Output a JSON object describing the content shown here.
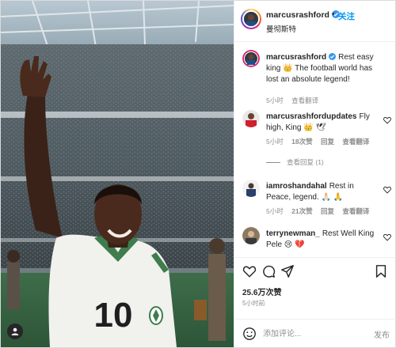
{
  "post": {
    "author": "marcusrashford",
    "follow_label": "关注",
    "dot": "•",
    "location": "曼彻斯特",
    "caption": "Rest easy king 👑 The football world has lost an absolute legend!",
    "caption_time": "5小时",
    "see_translation": "查看翻译",
    "jersey_number": "10"
  },
  "comments": [
    {
      "user": "marcusrashfordupdates",
      "text": "Fly high, King 👑 🕊",
      "time": "5小时",
      "likes": "18次赞",
      "reply": "回复",
      "translate": "查看翻译"
    },
    {
      "view_replies": "查看回复 (1)"
    },
    {
      "user": "iamroshandahal",
      "text": "Rest in Peace, legend. 🙏🏻 🙏",
      "time": "5小时",
      "likes": "21次赞",
      "reply": "回复",
      "translate": "查看翻译"
    },
    {
      "user": "terrynewman_",
      "text": "Rest Well King Pele 😢 💔"
    }
  ],
  "stats": {
    "likes": "25.6万次赞",
    "posted": "5小时前"
  },
  "add_comment": {
    "placeholder": "添加评论...",
    "post_label": "发布"
  },
  "colors": {
    "accent": "#0095f6",
    "verified": "#3897f0",
    "muted": "#8e8e8e",
    "text": "#262626"
  },
  "icons": [
    "verified-icon",
    "heart-icon",
    "comment-icon",
    "share-icon",
    "bookmark-icon",
    "emoji-icon",
    "tag-user-icon"
  ]
}
